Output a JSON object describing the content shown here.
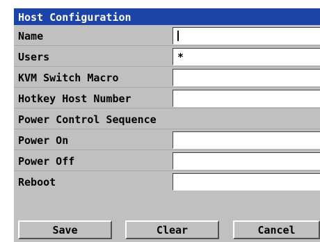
{
  "window": {
    "title": "Host Configuration"
  },
  "fields": [
    {
      "label": "Name",
      "value": ""
    },
    {
      "label": "Users",
      "value": "*"
    },
    {
      "label": "KVM Switch Macro",
      "value": ""
    },
    {
      "label": "Hotkey Host Number",
      "value": ""
    }
  ],
  "power": {
    "section_label": "Power Control Sequence",
    "fields": [
      {
        "label": "Power On",
        "value": ""
      },
      {
        "label": "Power Off",
        "value": ""
      },
      {
        "label": "Reboot",
        "value": ""
      }
    ]
  },
  "buttons": {
    "save": "Save",
    "clear": "Clear",
    "cancel": "Cancel"
  },
  "colors": {
    "titlebar": "#1c44a8",
    "panel": "#c0c0c0",
    "field": "#ffffff"
  }
}
